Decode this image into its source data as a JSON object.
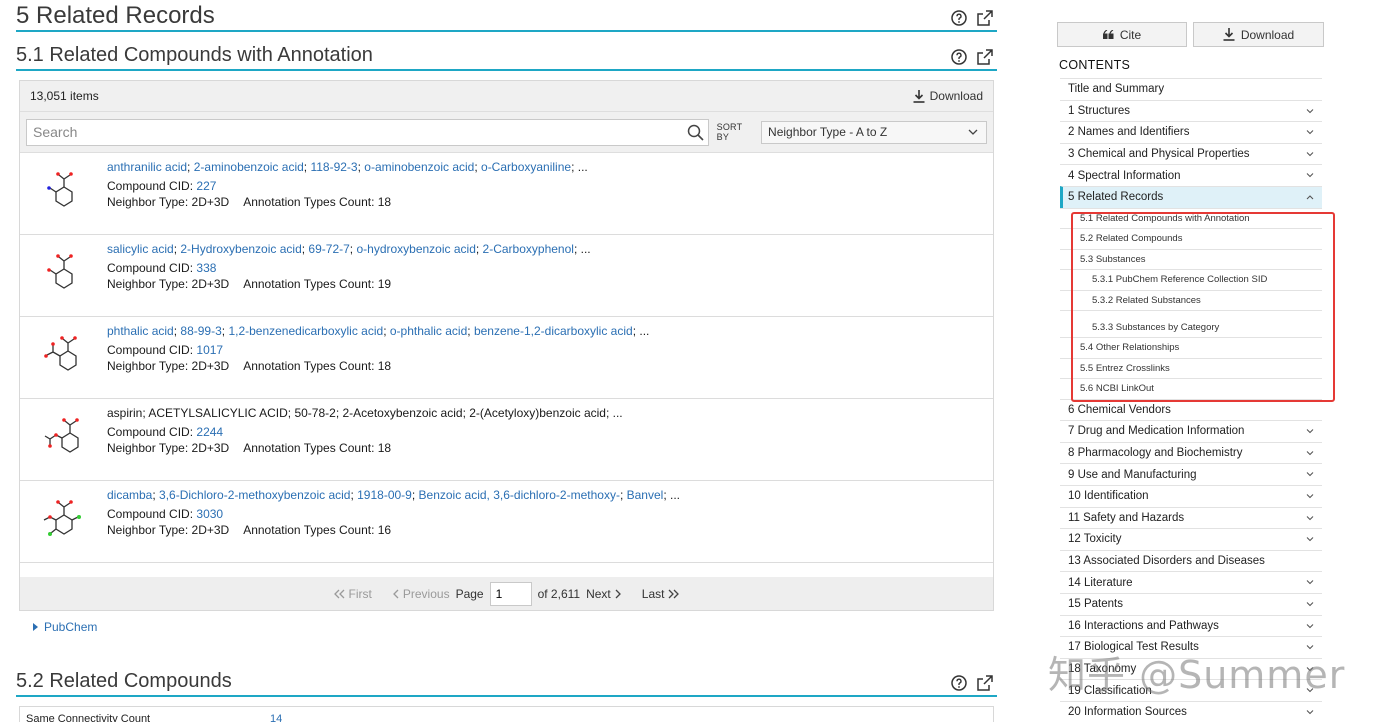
{
  "sections": {
    "s5": {
      "title": "5 Related Records"
    },
    "s51": {
      "title": "5.1 Related Compounds with Annotation"
    },
    "s52": {
      "title": "5.2 Related Compounds"
    }
  },
  "table": {
    "count": "13,051 items",
    "download_label": "Download",
    "search_placeholder": "Search",
    "sort_label": "SORT BY",
    "sort_value": "Neighbor Type - A to Z",
    "cid_label": "Compound CID:",
    "neighbor_label": "Neighbor Type:",
    "annotation_label": "Annotation Types Count:",
    "rows": [
      {
        "first": "anthranilic acid",
        "synonyms": [
          "2-aminobenzoic acid",
          "118-92-3",
          "o-aminobenzoic acid",
          "o-Carboxyaniline"
        ],
        "cid": "227",
        "neighbor": "2D+3D",
        "annotation": "18"
      },
      {
        "first": "salicylic acid",
        "synonyms": [
          "2-Hydroxybenzoic acid",
          "69-72-7",
          "o-hydroxybenzoic acid",
          "2-Carboxyphenol"
        ],
        "cid": "338",
        "neighbor": "2D+3D",
        "annotation": "19"
      },
      {
        "first": "phthalic acid",
        "synonyms": [
          "88-99-3",
          "1,2-benzenedicarboxylic acid",
          "o-phthalic acid",
          "benzene-1,2-dicarboxylic acid"
        ],
        "cid": "1017",
        "neighbor": "2D+3D",
        "annotation": "18"
      },
      {
        "first": "aspirin",
        "synonyms": [
          "ACETYLSALICYLIC ACID",
          "50-78-2",
          "2-Acetoxybenzoic acid",
          "2-(Acetyloxy)benzoic acid"
        ],
        "cid": "2244",
        "neighbor": "2D+3D",
        "annotation": "18"
      },
      {
        "first": "dicamba",
        "synonyms": [
          "3,6-Dichloro-2-methoxybenzoic acid",
          "1918-00-9",
          "Benzoic acid, 3,6-dichloro-2-methoxy-",
          "Banvel"
        ],
        "cid": "3030",
        "neighbor": "2D+3D",
        "annotation": "16"
      }
    ],
    "pager": {
      "first": "First",
      "previous": "Previous",
      "page_label": "Page",
      "page_value": "1",
      "of_label": "of 2,611",
      "next": "Next",
      "last": "Last"
    }
  },
  "pubchem_link": "PubChem",
  "bottom_row": {
    "label": "Same Connectivity Count",
    "value": "14"
  },
  "sidebar": {
    "cite_label": "Cite",
    "download_label": "Download",
    "contents_title": "CONTENTS",
    "items": [
      {
        "label": "Title and Summary",
        "chevron": false
      },
      {
        "label": "1 Structures",
        "chevron": true
      },
      {
        "label": "2 Names and Identifiers",
        "chevron": true
      },
      {
        "label": "3 Chemical and Physical Properties",
        "chevron": true
      },
      {
        "label": "4 Spectral Information",
        "chevron": true
      },
      {
        "label": "5 Related Records",
        "chevron": true,
        "active": true
      }
    ],
    "subitems": [
      {
        "label": "5.1 Related Compounds with Annotation",
        "level": 2
      },
      {
        "label": "5.2 Related Compounds",
        "level": 2
      },
      {
        "label": "5.3 Substances",
        "level": 2
      },
      {
        "label": "5.3.1 PubChem Reference Collection SID",
        "level": 3
      },
      {
        "label": "5.3.2 Related Substances",
        "level": 3
      },
      {
        "label": "5.3.3 Substances by Category",
        "level": 3
      },
      {
        "label": "5.4 Other Relationships",
        "level": 2
      },
      {
        "label": "5.5 Entrez Crosslinks",
        "level": 2
      },
      {
        "label": "5.6 NCBI LinkOut",
        "level": 2
      }
    ],
    "items_after": [
      {
        "label": "6 Chemical Vendors",
        "chevron": false
      },
      {
        "label": "7 Drug and Medication Information",
        "chevron": true
      },
      {
        "label": "8 Pharmacology and Biochemistry",
        "chevron": true
      },
      {
        "label": "9 Use and Manufacturing",
        "chevron": true
      },
      {
        "label": "10 Identification",
        "chevron": true
      },
      {
        "label": "11 Safety and Hazards",
        "chevron": true
      },
      {
        "label": "12 Toxicity",
        "chevron": true
      },
      {
        "label": "13 Associated Disorders and Diseases",
        "chevron": false
      },
      {
        "label": "14 Literature",
        "chevron": true
      },
      {
        "label": "15 Patents",
        "chevron": true
      },
      {
        "label": "16 Interactions and Pathways",
        "chevron": true
      },
      {
        "label": "17 Biological Test Results",
        "chevron": true
      },
      {
        "label": "18 Taxonomy",
        "chevron": true
      },
      {
        "label": "19 Classification",
        "chevron": true
      },
      {
        "label": "20 Information Sources",
        "chevron": true
      }
    ]
  },
  "watermark": "知乎 @Summer",
  "colors": {
    "accent": "#1ea7c5",
    "link": "#2b6fb3",
    "highlight": "#e53935"
  }
}
